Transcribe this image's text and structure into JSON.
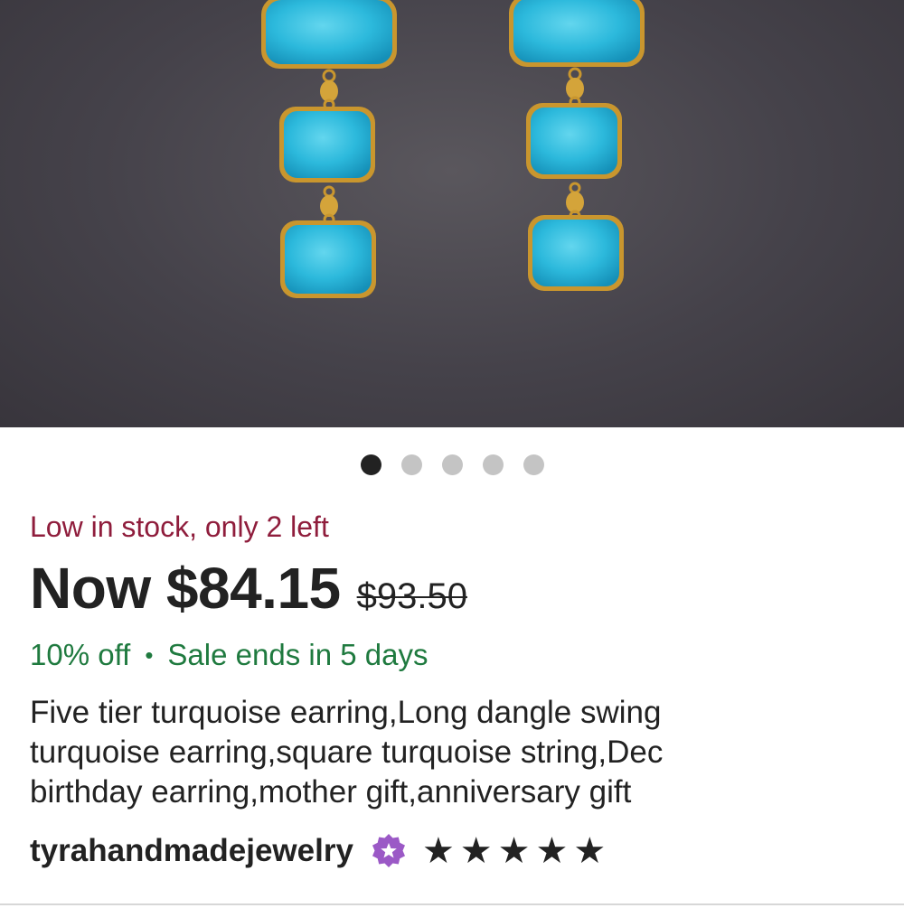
{
  "product": {
    "image_alt": "Five tier turquoise earrings",
    "gallery": {
      "count": 5,
      "active_index": 0
    },
    "stock_notice": "Low in stock, only 2 left",
    "price_now": "Now $84.15",
    "price_was": "$93.50",
    "discount": "10% off",
    "separator": "•",
    "sale_notice": "Sale ends in 5 days",
    "title_lines": [
      "Five tier turquoise earring,Long dangle swing",
      "turquoise earring,square turquoise string,Dec",
      "birthday earring,mother gift,anniversary gift"
    ]
  },
  "shop": {
    "name": "tyrahandmadejewelry",
    "badge_icon": "star-seller-badge-icon",
    "rating": 5,
    "rating_max": 5,
    "star_glyph": "★"
  },
  "colors": {
    "stock_text": "#8f1d3c",
    "sale_text": "#1f7a3f",
    "badge_purple": "#9b59c6",
    "turquoise": "#2cb9dc",
    "gold": "#d4a43a"
  }
}
